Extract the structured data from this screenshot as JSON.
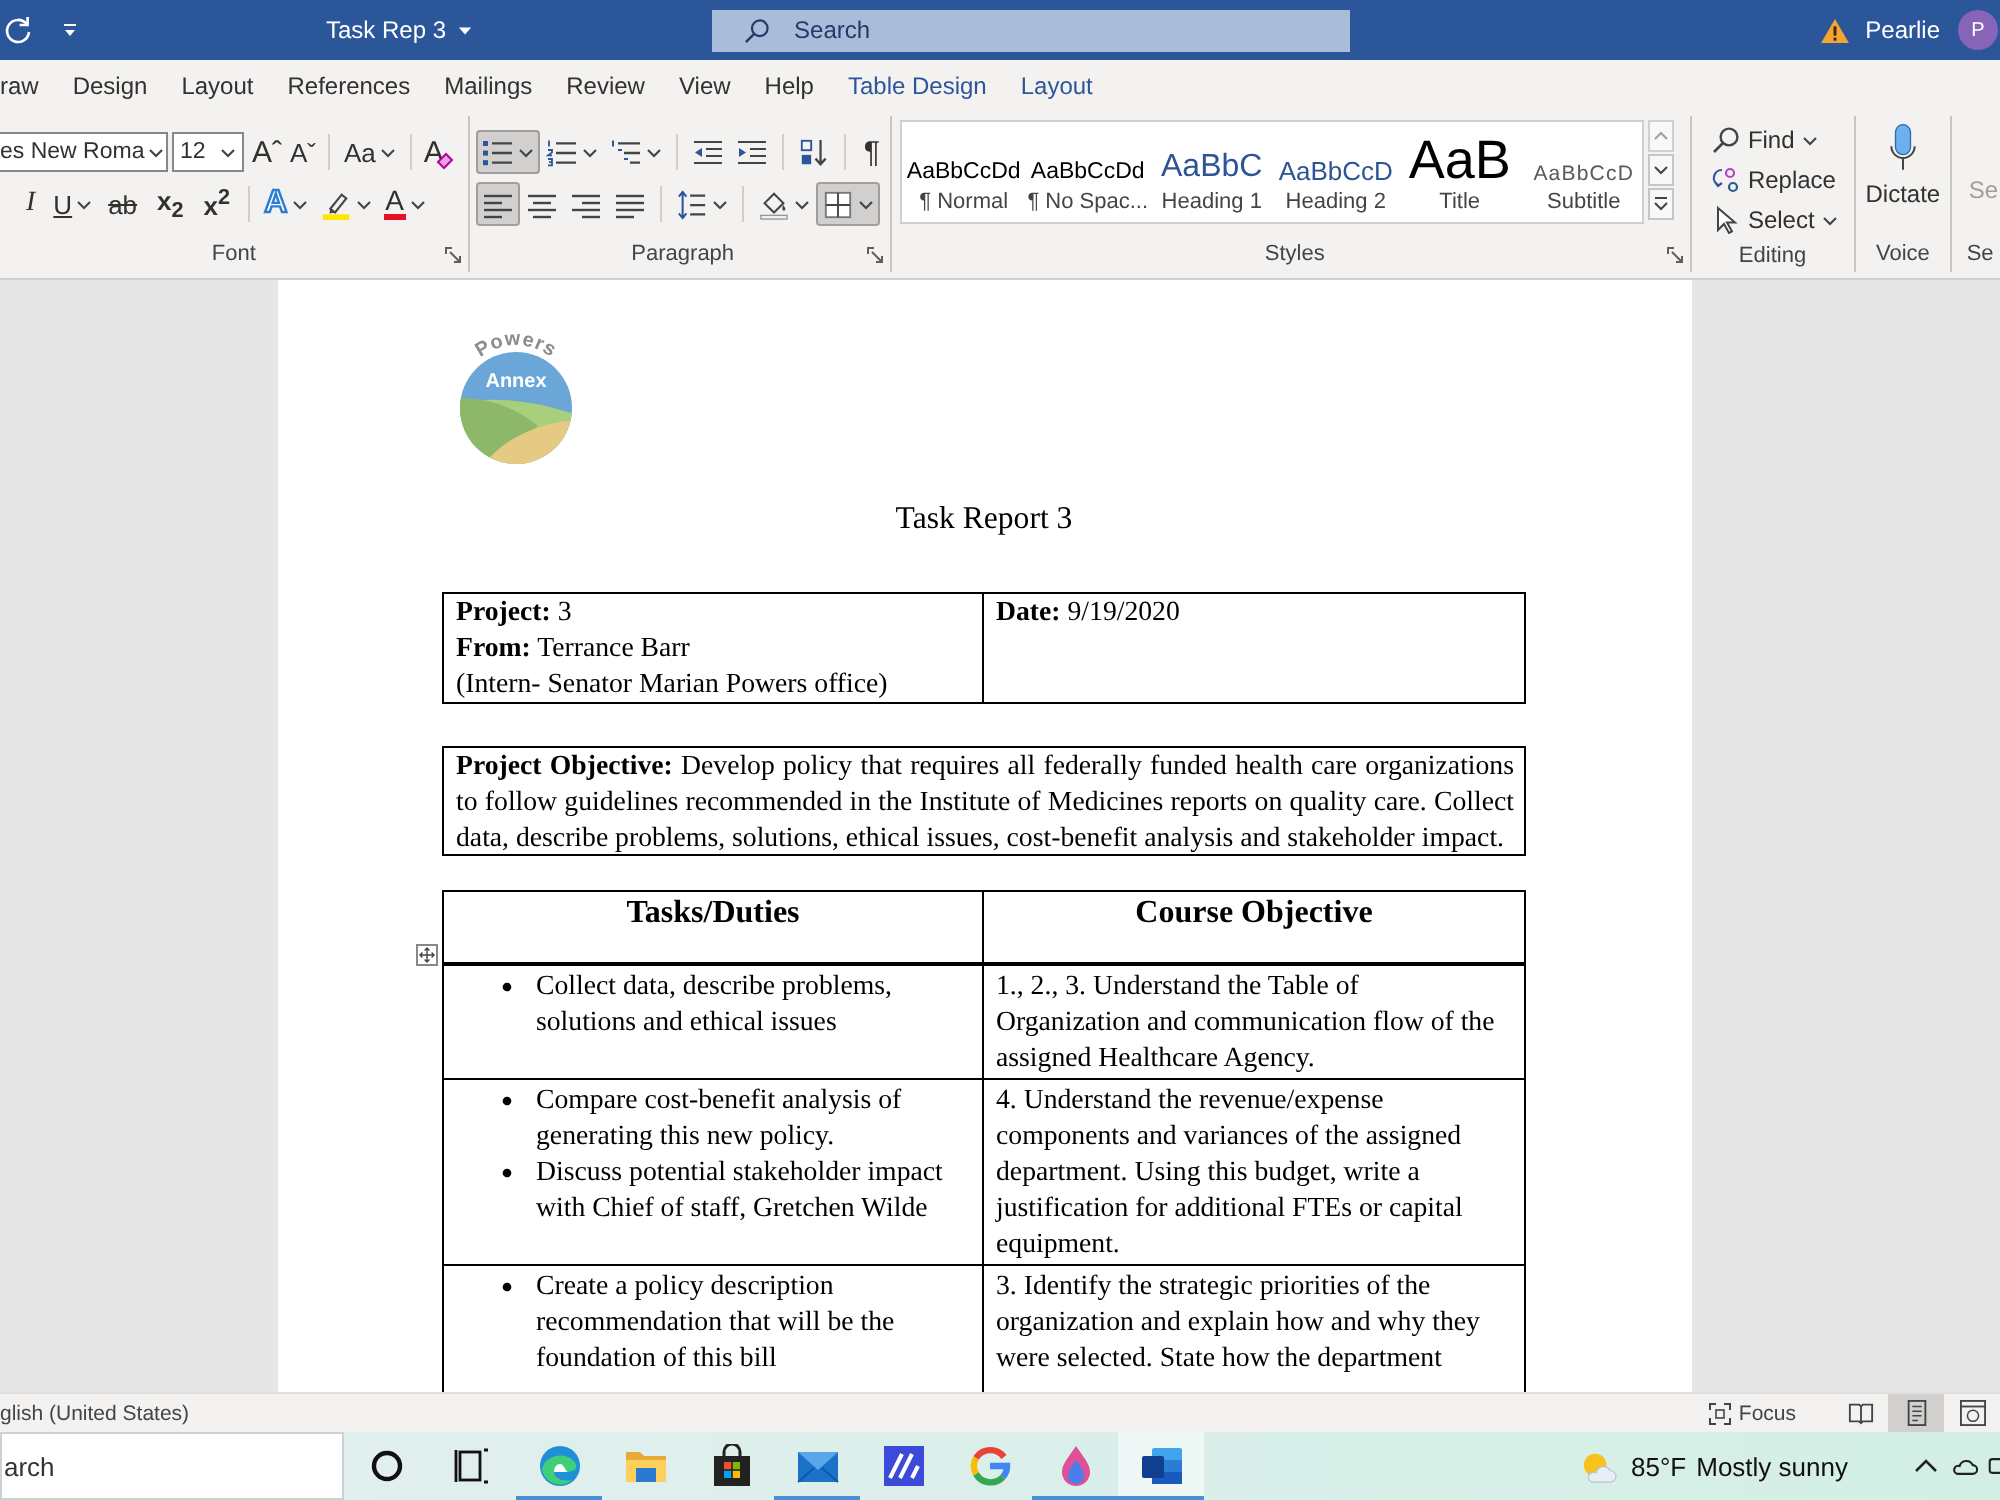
{
  "title_bar": {
    "title": "Task Rep 3",
    "search": {
      "placeholder": "Search"
    },
    "user": {
      "name": "Pearlie",
      "initial": "P"
    }
  },
  "ribbon_tabs": [
    {
      "label": "raw",
      "kind": "standard",
      "selected": false
    },
    {
      "label": "Design",
      "kind": "standard",
      "selected": false
    },
    {
      "label": "Layout",
      "kind": "standard",
      "selected": false
    },
    {
      "label": "References",
      "kind": "standard",
      "selected": false
    },
    {
      "label": "Mailings",
      "kind": "standard",
      "selected": false
    },
    {
      "label": "Review",
      "kind": "standard",
      "selected": false
    },
    {
      "label": "View",
      "kind": "standard",
      "selected": false
    },
    {
      "label": "Help",
      "kind": "standard",
      "selected": false
    },
    {
      "label": "Table Design",
      "kind": "contextual",
      "selected": false
    },
    {
      "label": "Layout",
      "kind": "contextual",
      "selected": false
    }
  ],
  "font_group": {
    "font_name": "es New Roma",
    "font_size": "12",
    "grow": "Aˆ",
    "shrink": "Aˇ",
    "change_case": "Aa",
    "clear_formatting": "A",
    "italic": "I",
    "underline": "U",
    "strikethrough": "ab",
    "subscript": "x$_{2}$",
    "superscript": "x$^{2}$",
    "text_effects": "A",
    "font_color": "A",
    "label": "Font"
  },
  "paragraph_group": {
    "list_buttons": [
      {
        "selected": true
      },
      {
        "selected": false
      },
      {
        "selected": false
      }
    ],
    "show_marks": "¶",
    "align_buttons": [
      {
        "selected": true
      },
      {
        "selected": false
      },
      {
        "selected": false
      },
      {
        "selected": false
      }
    ],
    "borders": {
      "selected": true
    },
    "label": "Paragraph"
  },
  "styles_group": {
    "items": [
      {
        "kind": "normal",
        "preview": "AaBbCcDd",
        "name": "¶ Normal"
      },
      {
        "kind": "no_spacing",
        "preview": "AaBbCcDd",
        "name": "¶ No Spac..."
      },
      {
        "kind": "heading1",
        "preview": "AaBbC",
        "name": "Heading 1"
      },
      {
        "kind": "heading2",
        "preview": "AaBbCcD",
        "name": "Heading 2"
      },
      {
        "kind": "title",
        "preview": "AaB",
        "name": "Title"
      },
      {
        "kind": "subtitle",
        "preview": "AaBbCcD",
        "name": "Subtitle"
      }
    ],
    "label": "Styles"
  },
  "editing_group": {
    "buttons": [
      {
        "label": "Find",
        "has_menu": true
      },
      {
        "label": "Replace",
        "has_menu": false
      },
      {
        "label": "Select",
        "has_menu": true
      }
    ],
    "label": "Editing"
  },
  "voice_group": {
    "button": "Dictate",
    "label": "Voice"
  },
  "sensitivity_group": {
    "button": "Se",
    "label": "Se"
  },
  "document": {
    "logo": {
      "top_text": "Powers",
      "inner_text": "Annex"
    },
    "title": "Task Report 3",
    "info_table": {
      "left": [
        "**Project:** 3",
        "**From:** Terrance Barr",
        "(Intern- Senator Marian Powers office)"
      ],
      "right": [
        "**Date:** 9/19/2020"
      ]
    },
    "objective": "**Project Objective:** Develop policy that requires all federally funded health care organizations to follow guidelines recommended in the Institute of Medicines reports on quality care. Collect data, describe problems, solutions, ethical issues, cost-benefit analysis and stakeholder impact.",
    "tasks_table": {
      "columns": [
        "Tasks/Duties",
        "Course Objective"
      ],
      "rows": [
        {
          "tasks": [
            "Collect data, describe problems, solutions and ethical issues"
          ],
          "objective": "1., 2., 3. Understand the Table of Organization and communication flow of the assigned Healthcare Agency."
        },
        {
          "tasks": [
            "Compare cost-benefit analysis of generating this new policy.",
            "Discuss potential stakeholder impact with Chief of staff, Gretchen Wilde"
          ],
          "objective": "4. Understand the revenue/expense components and variances of the assigned department. Using this budget, write a justification for additional FTEs or capital equipment."
        },
        {
          "tasks": [
            "Create a policy description recommendation that will be the foundation of this bill"
          ],
          "objective": "3. Identify the strategic priorities of the organization and explain how and why they were selected. State how the department"
        }
      ]
    }
  },
  "status_bar": {
    "language": "glish (United States)",
    "focus": "Focus",
    "views": [
      {
        "selected": false
      },
      {
        "selected": true
      },
      {
        "selected": false
      }
    ]
  },
  "taskbar": {
    "search": {
      "placeholder": "arch"
    },
    "apps": [
      {
        "running": true,
        "selected": false
      },
      {
        "running": false,
        "selected": false
      },
      {
        "running": false,
        "selected": false
      },
      {
        "running": true,
        "selected": false
      },
      {
        "running": false,
        "selected": false
      },
      {
        "running": false,
        "selected": false
      },
      {
        "running": true,
        "selected": false
      },
      {
        "running": true,
        "selected": true
      }
    ],
    "weather": {
      "temperature": "85°F",
      "condition": "Mostly sunny"
    }
  }
}
